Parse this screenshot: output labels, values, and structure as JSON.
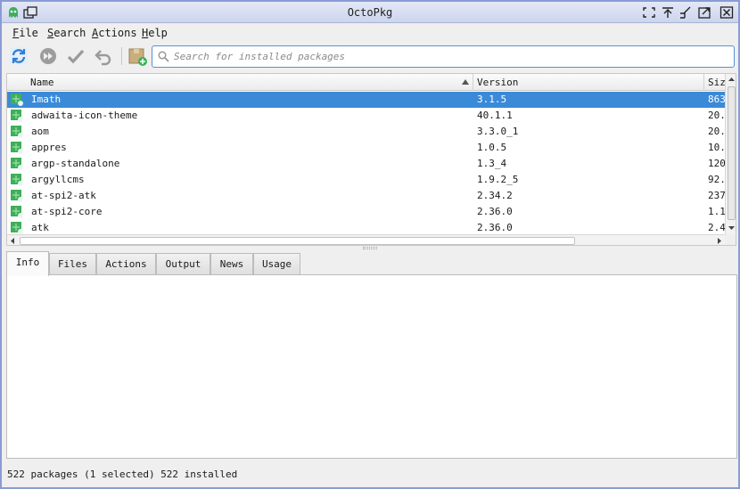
{
  "window": {
    "title": "OctoPkg"
  },
  "menu": [
    {
      "label": "File"
    },
    {
      "label": "Search"
    },
    {
      "label": "Actions"
    },
    {
      "label": "Help"
    }
  ],
  "toolbar": {
    "tools": [
      "sync-icon",
      "fast-forward-icon",
      "checkmark-icon",
      "undo-icon",
      "package-install-icon"
    ]
  },
  "search": {
    "placeholder": "Search for installed packages",
    "value": ""
  },
  "table": {
    "columns": [
      {
        "label": "Name",
        "sorted": "ascending"
      },
      {
        "label": "Version"
      },
      {
        "label": "Size"
      }
    ],
    "rows": [
      {
        "name": "Imath",
        "version": "3.1.5",
        "size": "863",
        "selected": true
      },
      {
        "name": "adwaita-icon-theme",
        "version": "40.1.1",
        "size": "20."
      },
      {
        "name": "aom",
        "version": "3.3.0_1",
        "size": "20."
      },
      {
        "name": "appres",
        "version": "1.0.5",
        "size": "10."
      },
      {
        "name": "argp-standalone",
        "version": "1.3_4",
        "size": "120"
      },
      {
        "name": "argyllcms",
        "version": "1.9.2_5",
        "size": "92."
      },
      {
        "name": "at-spi2-atk",
        "version": "2.34.2",
        "size": "237"
      },
      {
        "name": "at-spi2-core",
        "version": "2.36.0",
        "size": "1.1"
      },
      {
        "name": "atk",
        "version": "2.36.0",
        "size": "2.4"
      }
    ]
  },
  "tabs": [
    {
      "label": "Info",
      "active": true
    },
    {
      "label": "Files"
    },
    {
      "label": "Actions"
    },
    {
      "label": "Output"
    },
    {
      "label": "News"
    },
    {
      "label": "Usage"
    }
  ],
  "status": {
    "text": "522 packages (1 selected)  522 installed"
  },
  "colors": {
    "selection": "#3a8ad8",
    "accent": "#5b8fd6",
    "package_icon": "#3fae5a"
  }
}
